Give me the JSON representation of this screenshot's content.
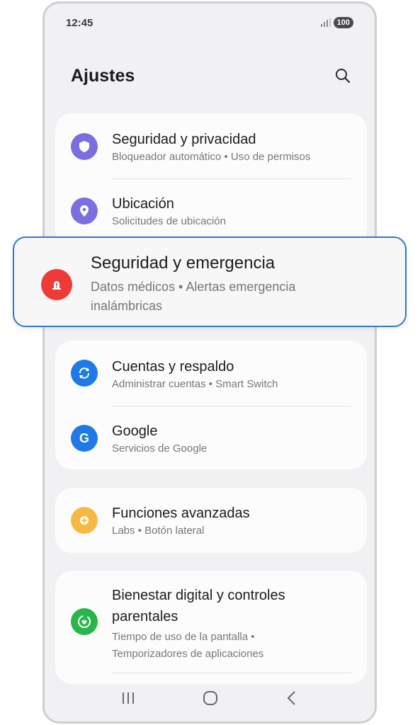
{
  "status": {
    "time": "12:45",
    "battery": "100"
  },
  "header": {
    "title": "Ajustes"
  },
  "items": {
    "security_privacy": {
      "title": "Seguridad y privacidad",
      "subtitle": "Bloqueador automático • Uso de permisos",
      "icon": "shield-icon",
      "color": "#7b6fe0"
    },
    "location": {
      "title": "Ubicación",
      "subtitle": "Solicitudes de ubicación",
      "icon": "location-pin-icon",
      "color": "#7b6fe0"
    },
    "safety_emergency": {
      "title": "Seguridad y emergencia",
      "subtitle": "Datos médicos • Alertas emergencia inalámbricas",
      "icon": "emergency-icon",
      "color": "#ee3b36"
    },
    "accounts_backup": {
      "title": "Cuentas y respaldo",
      "subtitle": "Administrar cuentas • Smart Switch",
      "icon": "sync-icon",
      "color": "#1f7ae8"
    },
    "google": {
      "title": "Google",
      "subtitle": "Servicios de Google",
      "icon": "google-icon",
      "color": "#1f7ae8"
    },
    "advanced": {
      "title": "Funciones avanzadas",
      "subtitle": "Labs • Botón lateral",
      "icon": "gear-plus-icon",
      "color": "#f6b945"
    },
    "wellbeing": {
      "title": "Bienestar digital y controles parentales",
      "subtitle": "Tiempo de uso de la pantalla • Temporizadores de aplicaciones",
      "icon": "wellbeing-icon",
      "color": "#27b64a"
    }
  },
  "highlight_color": "#2f79cf"
}
